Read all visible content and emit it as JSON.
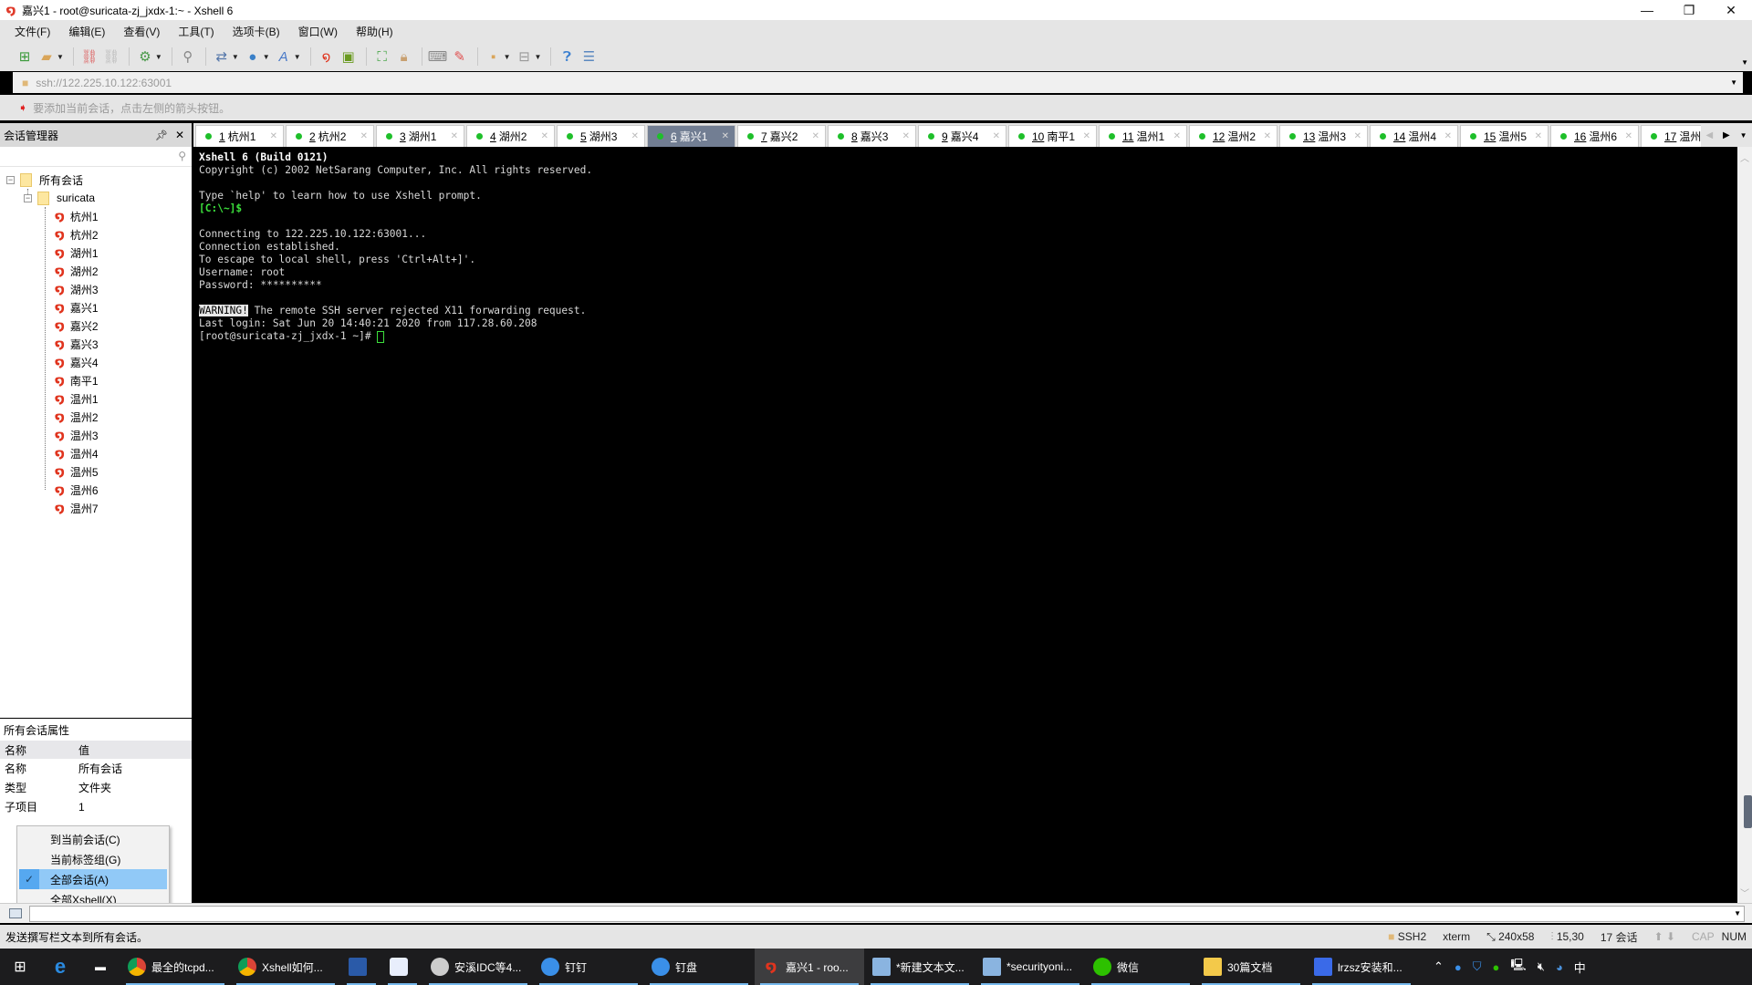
{
  "window": {
    "title": "嘉兴1 - root@suricata-zj_jxdx-1:~ - Xshell 6",
    "controls": {
      "minimize": "—",
      "restore": "❐",
      "close": "✕"
    }
  },
  "menu": [
    "文件(F)",
    "编辑(E)",
    "查看(V)",
    "工具(T)",
    "选项卡(B)",
    "窗口(W)",
    "帮助(H)"
  ],
  "toolbar": {
    "icons": [
      "new-session-icon",
      "open-folder-icon",
      "reconnect-icon",
      "disconnect-icon",
      "properties-icon",
      "find-icon",
      "transfer-icon",
      "globe-icon",
      "font-icon",
      "xshell-icon",
      "xftp-icon",
      "fullscreen-icon",
      "lock-icon",
      "keyboard-icon",
      "highlight-icon",
      "new-folder-icon",
      "layout-icon",
      "help-icon",
      "chat-icon"
    ]
  },
  "address": {
    "value": "ssh://122.225.10.122:63001"
  },
  "hint": {
    "text": "要添加当前会话，点击左侧的箭头按钮。"
  },
  "session_manager": {
    "title": "会话管理器",
    "search_placeholder": "",
    "root": "所有会话",
    "folder": "suricata",
    "sessions": [
      "杭州1",
      "杭州2",
      "湖州1",
      "湖州2",
      "湖州3",
      "嘉兴1",
      "嘉兴2",
      "嘉兴3",
      "嘉兴4",
      "南平1",
      "温州1",
      "温州2",
      "温州3",
      "温州4",
      "温州5",
      "温州6",
      "温州7"
    ]
  },
  "properties": {
    "title": "所有会话属性",
    "headers": [
      "名称",
      "值"
    ],
    "rows": [
      {
        "key": "名称",
        "value": "所有会话"
      },
      {
        "key": "类型",
        "value": "文件夹"
      },
      {
        "key": "子项目",
        "value": "1"
      }
    ]
  },
  "context_menu": {
    "items": [
      {
        "label": "到当前会话(C)",
        "checked": false
      },
      {
        "label": "当前标签组(G)",
        "checked": false
      },
      {
        "label": "全部会话(A)",
        "checked": true
      },
      {
        "label": "全部Xshell(X)",
        "checked": false
      }
    ]
  },
  "tabs": [
    {
      "num": "1",
      "label": "杭州1",
      "active": false
    },
    {
      "num": "2",
      "label": "杭州2",
      "active": false
    },
    {
      "num": "3",
      "label": "湖州1",
      "active": false
    },
    {
      "num": "4",
      "label": "湖州2",
      "active": false
    },
    {
      "num": "5",
      "label": "湖州3",
      "active": false
    },
    {
      "num": "6",
      "label": "嘉兴1",
      "active": true
    },
    {
      "num": "7",
      "label": "嘉兴2",
      "active": false
    },
    {
      "num": "8",
      "label": "嘉兴3",
      "active": false
    },
    {
      "num": "9",
      "label": "嘉兴4",
      "active": false
    },
    {
      "num": "10",
      "label": "南平1",
      "active": false
    },
    {
      "num": "11",
      "label": "温州1",
      "active": false
    },
    {
      "num": "12",
      "label": "温州2",
      "active": false
    },
    {
      "num": "13",
      "label": "温州3",
      "active": false
    },
    {
      "num": "14",
      "label": "温州4",
      "active": false
    },
    {
      "num": "15",
      "label": "温州5",
      "active": false
    },
    {
      "num": "16",
      "label": "温州6",
      "active": false
    },
    {
      "num": "17",
      "label": "温州",
      "active": false
    }
  ],
  "terminal": {
    "lines": [
      {
        "text": "Xshell 6 (Build 0121)",
        "style": "bold"
      },
      {
        "text": "Copyright (c) 2002 NetSarang Computer, Inc. All rights reserved.",
        "style": ""
      },
      {
        "text": "",
        "style": ""
      },
      {
        "text": "Type `help' to learn how to use Xshell prompt.",
        "style": ""
      },
      {
        "text": "[C:\\~]$",
        "style": "green"
      },
      {
        "text": "",
        "style": ""
      },
      {
        "text": "Connecting to 122.225.10.122:63001...",
        "style": ""
      },
      {
        "text": "Connection established.",
        "style": ""
      },
      {
        "text": "To escape to local shell, press 'Ctrl+Alt+]'.",
        "style": ""
      },
      {
        "text": "Username: root",
        "style": ""
      },
      {
        "text": "Password: **********",
        "style": ""
      },
      {
        "text": "",
        "style": ""
      },
      {
        "text": " The remote SSH server rejected X11 forwarding request.",
        "style": "warn",
        "prefix": "WARNING!"
      },
      {
        "text": "Last login: Sat Jun 20 14:40:21 2020 from 117.28.60.208",
        "style": ""
      },
      {
        "text": "[root@suricata-zj_jxdx-1 ~]# ",
        "style": "prompt"
      }
    ]
  },
  "compose": {
    "value": ""
  },
  "status": {
    "message": "发送撰写栏文本到所有会话。",
    "protocol": "SSH2",
    "term_type": "xterm",
    "size": "240x58",
    "cursor": "15,30",
    "sessions": "17 会话",
    "cap": "CAP",
    "num": "NUM"
  },
  "taskbar": {
    "apps": [
      {
        "label": "最全的tcpd...",
        "icon": "chrome-icon",
        "active": false
      },
      {
        "label": "Xshell如何...",
        "icon": "chrome-icon",
        "active": false
      },
      {
        "label": "",
        "icon": "remote-desktop-icon",
        "active": false
      },
      {
        "label": "",
        "icon": "feishu-icon",
        "active": false
      },
      {
        "label": "安溪IDC等4...",
        "icon": "chat-avatar-icon",
        "active": false
      },
      {
        "label": "钉钉",
        "icon": "dingtalk-icon",
        "active": false
      },
      {
        "label": "钉盘",
        "icon": "dingtalk-icon",
        "active": false
      },
      {
        "label": "嘉兴1 - roo...",
        "icon": "xshell-icon",
        "active": true
      },
      {
        "label": "*新建文本文...",
        "icon": "notepad-icon",
        "active": false
      },
      {
        "label": "*securityoni...",
        "icon": "notepad-icon",
        "active": false
      },
      {
        "label": "微信",
        "icon": "wechat-icon",
        "active": false
      },
      {
        "label": "30篇文档",
        "icon": "folder-icon",
        "active": false
      },
      {
        "label": "lrzsz安装和...",
        "icon": "wps-icon",
        "active": false
      }
    ],
    "tray": {
      "ime": "中"
    }
  }
}
